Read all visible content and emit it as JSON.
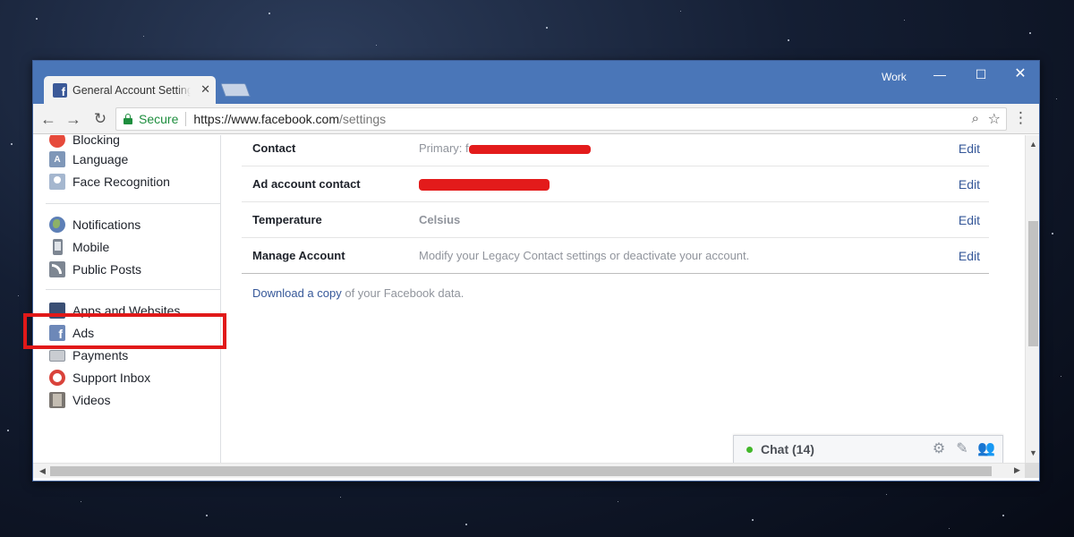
{
  "browser": {
    "tab_title": "General Account Settings",
    "tab_close": "✕",
    "profile_name": "Work",
    "window_controls": {
      "minimize": "—",
      "maximize": "☐",
      "close": "✕"
    },
    "secure_label": "Secure",
    "url_host": "https://www.facebook.com",
    "url_path": "/settings",
    "icons": {
      "back": "arrow-left-icon",
      "forward": "arrow-right-icon",
      "reload": "reload-icon",
      "zoom": "zoom-icon",
      "bookmark": "star-icon",
      "menu": "kebab-menu-icon",
      "lock": "lock-icon"
    }
  },
  "sidebar": {
    "items": [
      {
        "label": "Blocking",
        "icon": "blocking-icon"
      },
      {
        "label": "Language",
        "icon": "language-icon"
      },
      {
        "label": "Face Recognition",
        "icon": "face-recognition-icon"
      },
      {
        "label": "Notifications",
        "icon": "globe-icon"
      },
      {
        "label": "Mobile",
        "icon": "mobile-icon"
      },
      {
        "label": "Public Posts",
        "icon": "rss-icon"
      },
      {
        "label": "Apps and Websites",
        "icon": "apps-icon"
      },
      {
        "label": "Ads",
        "icon": "ads-icon"
      },
      {
        "label": "Payments",
        "icon": "payments-icon"
      },
      {
        "label": "Support Inbox",
        "icon": "support-icon"
      },
      {
        "label": "Videos",
        "icon": "videos-icon"
      }
    ]
  },
  "settings": {
    "edit_label": "Edit",
    "rows": [
      {
        "label": "Contact",
        "value_prefix": "Primary: f"
      },
      {
        "label": "Ad account contact",
        "value_prefix": ""
      },
      {
        "label": "Temperature",
        "value": "Celsius"
      },
      {
        "label": "Manage Account",
        "value": "Modify your Legacy Contact settings or deactivate your account."
      }
    ],
    "download_link": "Download a copy",
    "download_suffix": " of your Facebook data."
  },
  "chat": {
    "label": "Chat (14)",
    "icons": [
      "gear-icon",
      "compose-icon",
      "friends-icon"
    ]
  },
  "annotation": {
    "highlight_color": "#e11919",
    "highlighted_item": "Ads"
  },
  "colors": {
    "titlebar": "#4a76b8",
    "facebook_link": "#365899",
    "secure_green": "#1e8e3e",
    "redaction": "#e31b1b",
    "online": "#42b72a"
  }
}
